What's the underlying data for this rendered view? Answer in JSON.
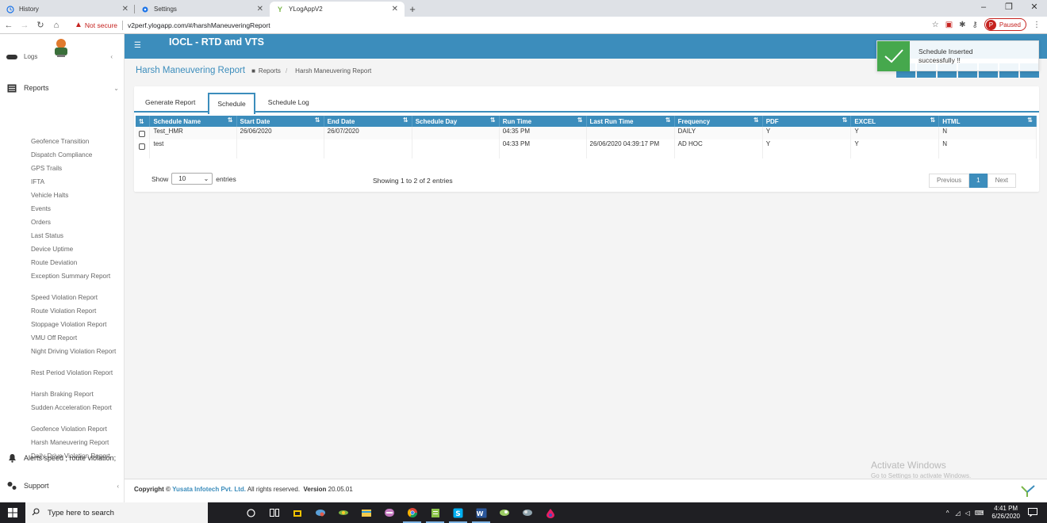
{
  "browser": {
    "tabs": [
      {
        "title": "History",
        "icon": "history-icon"
      },
      {
        "title": "Settings",
        "icon": "gear-icon"
      },
      {
        "title": "YLogAppV2",
        "icon": "ylog-icon"
      }
    ],
    "not_secure": "Not secure",
    "url": "v2perf.ylogapp.com/#/harshManeuveringReport",
    "profile_initial": "P",
    "profile_status": "Paused"
  },
  "sidebar": {
    "top_item": "Logs",
    "reports_label": "Reports",
    "report_items": [
      "Geofence Transition",
      "Dispatch Compliance",
      "GPS Trails",
      "IFTA",
      "Vehicle Halts",
      "Events",
      "Orders",
      "Last Status",
      "Device Uptime",
      "Route Deviation",
      "Exception Summary Report",
      "Speed Violation Report",
      "Route Violation Report",
      "Stoppage Violation Report",
      "VMU Off Report",
      "Night Driving Violation Report",
      "Rest Period Violation Report",
      "Harsh Braking Report",
      "Sudden Acceleration Report",
      "Geofence Violation Report",
      "Harsh Maneuvering Report",
      "Daily Drive Violation Report"
    ],
    "alerts_label": "Alerts speed ; route violation;",
    "support_label": "Support"
  },
  "header": {
    "app_title": "IOCL - RTD and VTS"
  },
  "page": {
    "title": "Harsh Maneuvering Report",
    "breadcrumb": [
      "Reports",
      "Harsh Maneuvering Report"
    ]
  },
  "toast": {
    "line1": "Schedule Inserted",
    "line2": "successfully !!"
  },
  "tabs": [
    "Generate Report",
    "Schedule",
    "Schedule Log"
  ],
  "active_tab": "Schedule",
  "table": {
    "columns": [
      "Schedule Name",
      "Start Date",
      "End Date",
      "Schedule Day",
      "Run Time",
      "Last Run Time",
      "Frequency",
      "PDF",
      "EXCEL",
      "HTML"
    ],
    "rows": [
      {
        "name": "Test_HMR",
        "start": "26/06/2020",
        "end": "26/07/2020",
        "day": "",
        "run": "04:35 PM",
        "last_run": "",
        "freq": "DAILY",
        "pdf": "Y",
        "excel": "Y",
        "html": "N"
      },
      {
        "name": "test",
        "start": "",
        "end": "",
        "day": "",
        "run": "04:33 PM",
        "last_run": "26/06/2020 04:39:17 PM",
        "freq": "AD HOC",
        "pdf": "Y",
        "excel": "Y",
        "html": "N"
      }
    ]
  },
  "pagination": {
    "show_label": "Show",
    "entries_value": "10",
    "entries_label": "entries",
    "info": "Showing 1 to 2 of 2 entries",
    "prev": "Previous",
    "current": "1",
    "next": "Next"
  },
  "footer": {
    "prefix": "Copyright ©",
    "company": "Yusata Infotech Pvt. Ltd.",
    "rights": "All rights reserved.",
    "version_label": "Version",
    "version": "20.05.01"
  },
  "watermark": {
    "line1": "Activate Windows",
    "line2": "Go to Settings to activate Windows."
  },
  "taskbar": {
    "search_placeholder": "Type here to search",
    "time": "4:41 PM",
    "date": "6/26/2020"
  },
  "colors": {
    "primary": "#3c8dbc",
    "success": "#46a84d",
    "taskbar": "#1f1f23"
  }
}
